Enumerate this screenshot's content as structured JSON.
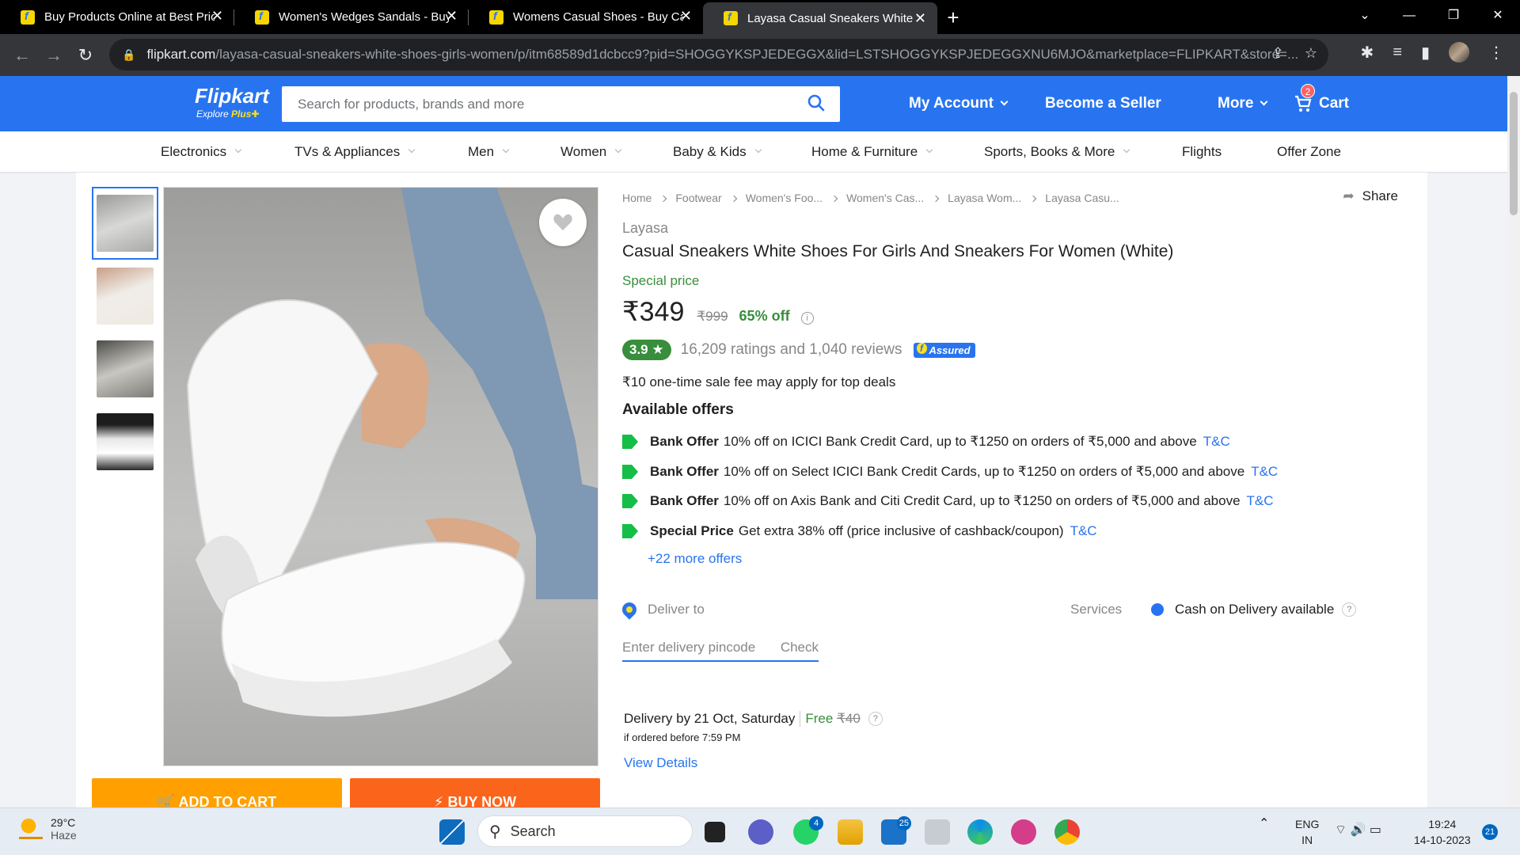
{
  "browser": {
    "tabs": [
      {
        "title": "Buy Products Online at Best Price"
      },
      {
        "title": "Women's Wedges Sandals - Buy"
      },
      {
        "title": "Womens Casual Shoes - Buy Casual"
      },
      {
        "title": "Layasa Casual Sneakers White Shoes"
      }
    ],
    "url_host": "flipkart.com",
    "url_path": "/layasa-casual-sneakers-white-shoes-girls-women/p/itm68589d1dcbcc9?pid=SHOGGYKSPJEDEGGX&lid=LSTSHOGGYKSPJEDEGGXNU6MJO&marketplace=FLIPKART&store=..."
  },
  "header": {
    "logo": "Flipkart",
    "logo_sub": "Explore",
    "logo_plus": "Plus",
    "search_placeholder": "Search for products, brands and more",
    "my_account": "My Account",
    "become_seller": "Become a Seller",
    "more": "More",
    "cart": "Cart",
    "cart_count": "2",
    "brand_color": "#2874f0"
  },
  "categories": [
    "Electronics",
    "TVs & Appliances",
    "Men",
    "Women",
    "Baby & Kids",
    "Home & Furniture",
    "Sports, Books & More",
    "Flights",
    "Offer Zone"
  ],
  "gallery": {
    "add_to_cart": "ADD TO CART",
    "buy_now": "BUY NOW"
  },
  "product": {
    "breadcrumbs": [
      "Home",
      "Footwear",
      "Women's Foo...",
      "Women's Cas...",
      "Layasa Wom...",
      "Layasa Casu..."
    ],
    "share": "Share",
    "brand": "Layasa",
    "title": "Casual Sneakers White Shoes For Girls And Sneakers For Women  (White)",
    "special_price": "Special price",
    "price": "₹349",
    "mrp": "₹999",
    "discount": "65% off",
    "rating": "3.9",
    "ratings_reviews": "16,209 ratings and 1,040 reviews",
    "assured": "Assured",
    "fee_note": "₹10 one-time sale fee may apply for top deals",
    "offers_title": "Available offers",
    "offers": [
      {
        "type": "Bank Offer",
        "text": "10% off on ICICI Bank Credit Card, up to ₹1250 on orders of ₹5,000 and above",
        "link": "T&C"
      },
      {
        "type": "Bank Offer",
        "text": "10% off on Select ICICI Bank Credit Cards, up to ₹1250 on orders of ₹5,000 and above",
        "link": "T&C"
      },
      {
        "type": "Bank Offer",
        "text": "10% off on Axis Bank and Citi Credit Card, up to ₹1250 on orders of ₹5,000 and above",
        "link": "T&C"
      },
      {
        "type": "Special Price",
        "text": "Get extra 38% off (price inclusive of cashback/coupon)",
        "link": "T&C"
      }
    ],
    "more_offers": "+22 more offers",
    "deliver_to": "Deliver to",
    "pincode_placeholder": "Enter delivery pincode",
    "check": "Check",
    "services": "Services",
    "cod": "Cash on Delivery available",
    "delivery_date": "Delivery by 21 Oct, Saturday",
    "free": "Free",
    "delivery_fee": "₹40",
    "ordered_before": "if ordered before 7:59 PM",
    "view_details": "View Details"
  },
  "taskbar": {
    "temp": "29°C",
    "weather": "Haze",
    "search": "Search",
    "whatsapp_badge": "4",
    "mail_badge": "25",
    "lang1": "ENG",
    "lang2": "IN",
    "time": "19:24",
    "date": "14-10-2023",
    "notifications": "21"
  }
}
